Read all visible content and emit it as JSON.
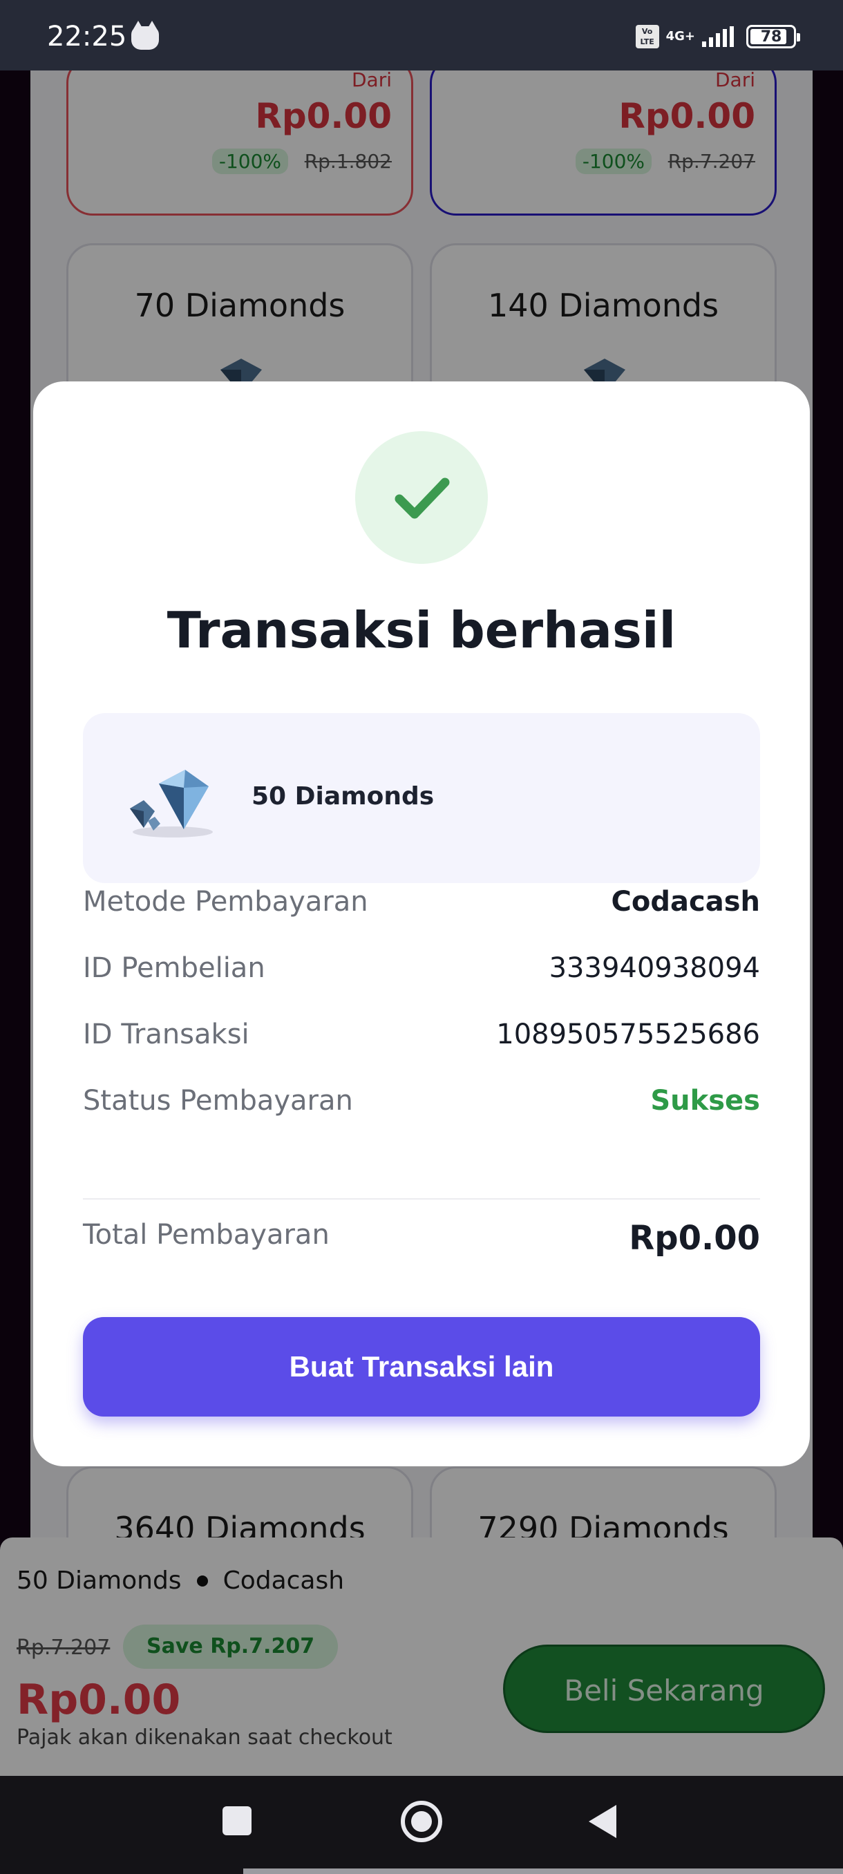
{
  "status_bar": {
    "time": "22:25",
    "volte": "Vo LTE",
    "network": "4G+",
    "battery": "78"
  },
  "background": {
    "top_cards": [
      {
        "dari": "Dari",
        "price": "Rp0.00",
        "discount": "-100%",
        "old_price": "Rp.1.802",
        "accent": "#e8515a"
      },
      {
        "dari": "Dari",
        "price": "Rp0.00",
        "discount": "-100%",
        "old_price": "Rp.7.207",
        "accent": "#2a1cc9"
      }
    ],
    "mid_cards": [
      {
        "name": "70 Diamonds"
      },
      {
        "name": "140 Diamonds"
      }
    ],
    "bottom_cards": [
      {
        "name": "3640 Diamonds"
      },
      {
        "name": "7290 Diamonds"
      }
    ]
  },
  "modal": {
    "icon": "check-icon",
    "title": "Transaksi berhasil",
    "product": {
      "name": "50 Diamonds",
      "icon": "diamond-icon"
    },
    "rows": [
      {
        "label": "Metode Pembayaran",
        "value": "Codacash"
      },
      {
        "label": "ID Pembelian",
        "value": "333940938094"
      },
      {
        "label": "ID Transaksi",
        "value": "108950575525686"
      },
      {
        "label": "Status Pembayaran",
        "value": "Sukses"
      }
    ],
    "total": {
      "label": "Total Pembayaran",
      "value": "Rp0.00"
    },
    "button_label": "Buat Transaksi lain",
    "button_color": "#5b4ce8",
    "success_color": "#2e9a47"
  },
  "bottom_bar": {
    "item": "50 Diamonds",
    "method": "Codacash",
    "old_price": "Rp.7.207",
    "save": "Save Rp.7.207",
    "price": "Rp0.00",
    "tax_note": "Pajak akan dikenakan saat checkout",
    "buy_label": "Beli Sekarang"
  },
  "nav_bar": {
    "recents": "recents-icon",
    "home": "home-icon",
    "back": "back-icon"
  }
}
